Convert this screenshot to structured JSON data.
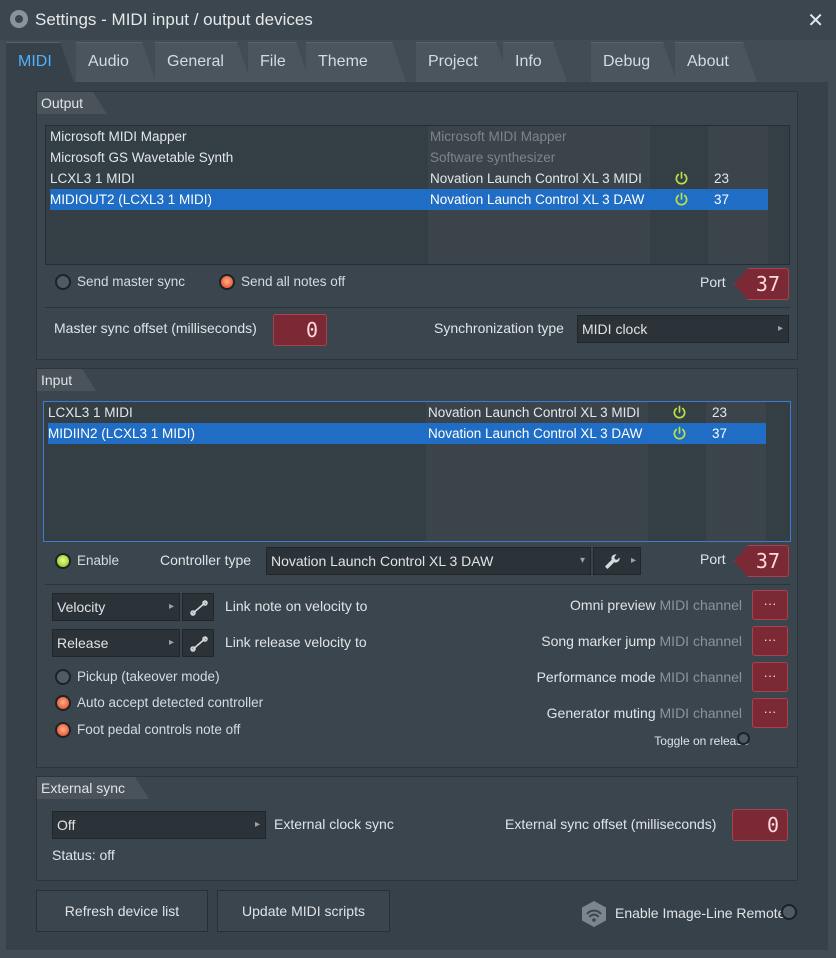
{
  "window": {
    "title": "Settings - MIDI input / output devices",
    "close": "✕"
  },
  "tabs": [
    {
      "label": "MIDI",
      "active": true
    },
    {
      "label": "Audio"
    },
    {
      "label": "General"
    },
    {
      "label": "File"
    },
    {
      "label": "Theme"
    },
    {
      "label": "Project"
    },
    {
      "label": "Info"
    },
    {
      "label": "Debug"
    },
    {
      "label": "About"
    }
  ],
  "output": {
    "section_label": "Output",
    "devices": [
      {
        "name": "Microsoft MIDI Mapper",
        "controller": "Microsoft MIDI Mapper",
        "dim": true,
        "enabled": false,
        "port": ""
      },
      {
        "name": "Microsoft GS Wavetable Synth",
        "controller": "Software synthesizer",
        "dim": true,
        "enabled": false,
        "port": ""
      },
      {
        "name": "LCXL3 1 MIDI",
        "controller": "Novation Launch Control XL 3 MIDI",
        "dim": false,
        "enabled": true,
        "port": "23"
      },
      {
        "name": "MIDIOUT2 (LCXL3 1 MIDI)",
        "controller": "Novation Launch Control XL 3 DAW",
        "dim": false,
        "enabled": true,
        "port": "37",
        "selected": true
      }
    ],
    "send_master_sync": "Send master sync",
    "send_all_notes_off": "Send all notes off",
    "port_label": "Port",
    "port_value": "37",
    "master_sync_offset_label": "Master sync offset (milliseconds)",
    "master_sync_offset_value": "0",
    "sync_type_label": "Synchronization type",
    "sync_type_value": "MIDI clock"
  },
  "input": {
    "section_label": "Input",
    "devices": [
      {
        "name": "LCXL3 1 MIDI",
        "controller": "Novation Launch Control XL 3 MIDI",
        "enabled": true,
        "port": "23"
      },
      {
        "name": "MIDIIN2 (LCXL3 1 MIDI)",
        "controller": "Novation Launch Control XL 3 DAW",
        "enabled": true,
        "port": "37",
        "selected": true
      }
    ],
    "enable_label": "Enable",
    "controller_type_label": "Controller type",
    "controller_type_value": "Novation Launch Control XL 3 DAW",
    "port_label": "Port",
    "port_value": "37",
    "velocity_select": "Velocity",
    "link_velocity_label": "Link note on velocity to",
    "release_select": "Release",
    "link_release_label": "Link release velocity to",
    "pickup_label": "Pickup (takeover mode)",
    "auto_accept_label": "Auto accept detected controller",
    "foot_pedal_label": "Foot pedal controls note off",
    "omni_preview": "Omni preview",
    "song_marker_jump": "Song marker jump",
    "performance_mode": "Performance mode",
    "generator_muting": "Generator muting",
    "midi_channel": "MIDI channel",
    "dots": "···",
    "toggle_on_release": "Toggle on release"
  },
  "external_sync": {
    "section_label": "External sync",
    "clock_select": "Off",
    "clock_label": "External clock sync",
    "offset_label": "External sync offset (milliseconds)",
    "offset_value": "0",
    "status": "Status: off"
  },
  "footer": {
    "refresh_button": "Refresh device list",
    "update_button": "Update MIDI scripts",
    "remote_label": "Enable Image-Line Remote"
  },
  "colors": {
    "accent_blue": "#1f6dc4",
    "tab_active_text": "#4fb1ff",
    "numbox_red": "#7b2a35",
    "power_green": "#b8e04a"
  }
}
